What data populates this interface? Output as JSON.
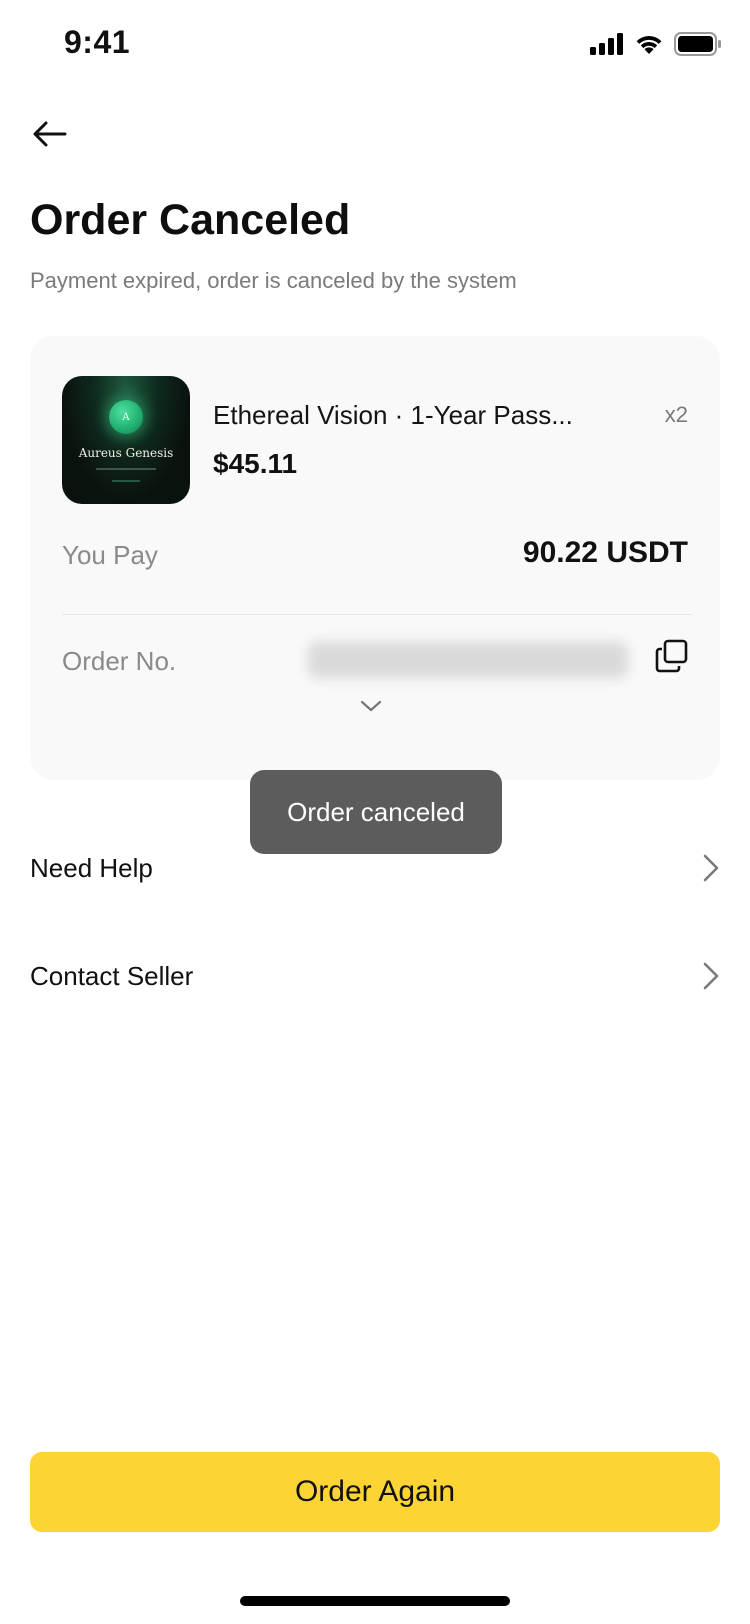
{
  "status_bar": {
    "time": "9:41",
    "signal_icon": "signal-icon",
    "wifi_icon": "wifi-icon",
    "battery_icon": "battery-icon"
  },
  "header": {
    "back_icon": "arrow-left-icon",
    "title": "Order Canceled",
    "subtitle": "Payment expired, order is canceled by the system"
  },
  "order": {
    "product": {
      "thumbnail_badge": "A",
      "thumbnail_title": "Aureus Genesis",
      "name": "Ethereal Vision · 1-Year Pass...",
      "quantity": "x2",
      "price": "$45.11"
    },
    "pay_label": "You Pay",
    "pay_value": "90.22 USDT",
    "order_no_label": "Order No.",
    "copy_icon": "copy-icon",
    "expand_icon": "chevron-down-icon"
  },
  "toast": {
    "message": "Order canceled"
  },
  "menu": {
    "items": [
      {
        "label": "Need Help",
        "icon": "chevron-right-icon"
      },
      {
        "label": "Contact Seller",
        "icon": "chevron-right-icon"
      }
    ]
  },
  "footer": {
    "cta_label": "Order Again",
    "cta_color": "#FCD535"
  },
  "colors": {
    "accent": "#FCD535",
    "card_bg": "#F9F9F9",
    "muted_text": "#8A8A8A",
    "toast_bg": "#555555"
  }
}
